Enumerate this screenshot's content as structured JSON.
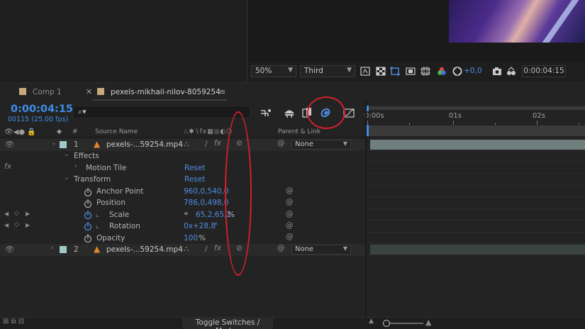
{
  "viewer": {
    "zoom": "50%",
    "resolution": "Third",
    "exposure": "+0,0",
    "timecode": "0:00:04:15"
  },
  "tabs": [
    {
      "label": "Comp 1",
      "swatch": "#c8a97c"
    },
    {
      "label": "pexels-mikhail-nilov-8059254",
      "swatch": "#c8a97c"
    }
  ],
  "timeline": {
    "current_time": "0:00:04:15",
    "frame_info": "00115 (25.00 fps)",
    "ruler": [
      "0:00s",
      "01s",
      "02s"
    ],
    "columns": {
      "source_name": "Source Name",
      "parent": "Parent & Link"
    },
    "layers": [
      {
        "index": "1",
        "name": "pexels-...59254.mp4",
        "parent": "None",
        "label_color": "#9fc8c8"
      },
      {
        "index": "2",
        "name": "pexels-...59254.mp4",
        "parent": "None",
        "label_color": "#9fc8c8"
      }
    ],
    "groups": {
      "effects": "Effects",
      "motion_tile": "Motion Tile",
      "transform": "Transform",
      "reset": "Reset"
    },
    "properties": [
      {
        "name": "Anchor Point",
        "value": "960,0,540,0",
        "unit": ""
      },
      {
        "name": "Position",
        "value": "786,0,498,0",
        "unit": ""
      },
      {
        "name": "Scale",
        "value": "65,2,65,2",
        "unit": "%"
      },
      {
        "name": "Rotation",
        "value": "0x+28,8",
        "unit": "°"
      },
      {
        "name": "Opacity",
        "value": "100",
        "unit": "%"
      }
    ],
    "fx_label": "fx"
  },
  "bottom": {
    "toggle_label": "Toggle Switches / Modes"
  },
  "colors": {
    "accent": "#3d8de6",
    "annotation": "#d6202a"
  }
}
